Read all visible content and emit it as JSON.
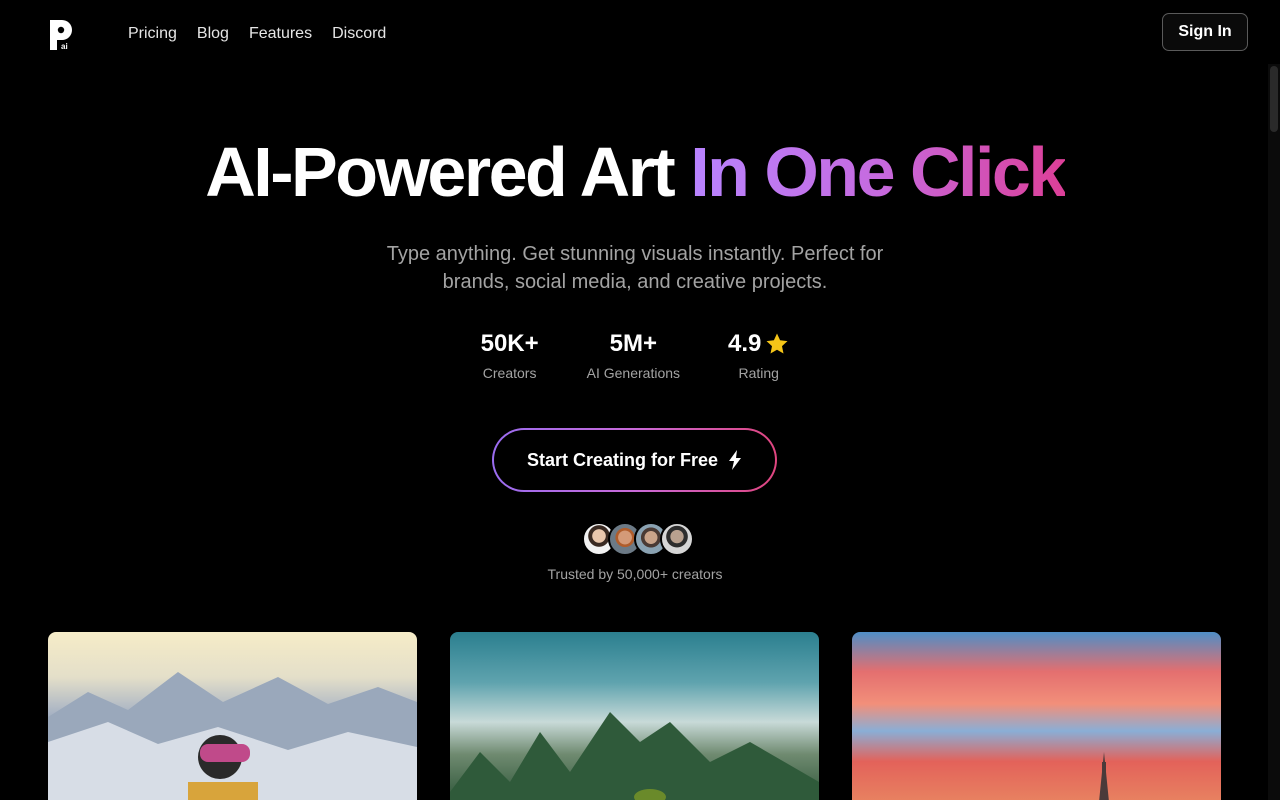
{
  "nav": {
    "logo_icon": "p-ai-logo",
    "links": [
      "Pricing",
      "Blog",
      "Features",
      "Discord"
    ],
    "signin_label": "Sign In"
  },
  "hero": {
    "title_plain": "AI-Powered Art",
    "title_gradient": "In One Click",
    "subtitle": "Type anything. Get stunning visuals instantly. Perfect for brands, social media, and creative projects."
  },
  "stats": [
    {
      "value": "50K+",
      "label": "Creators"
    },
    {
      "value": "5M+",
      "label": "AI Generations"
    },
    {
      "value": "4.9",
      "label": "Rating",
      "icon": "star-icon"
    }
  ],
  "cta": {
    "label": "Start Creating for Free",
    "icon": "bolt-icon"
  },
  "social_proof": {
    "avatars": 4,
    "text": "Trusted by 50,000+ creators"
  },
  "gallery": [
    {
      "subject": "skier-mountains"
    },
    {
      "subject": "misty-karst-mountains"
    },
    {
      "subject": "sunset-sky-spire"
    }
  ],
  "colors": {
    "background": "#000000",
    "gradient_start": "#b884ff",
    "gradient_end": "#dc3f98",
    "muted_text": "#a3a3a3",
    "star": "#f5c518"
  }
}
